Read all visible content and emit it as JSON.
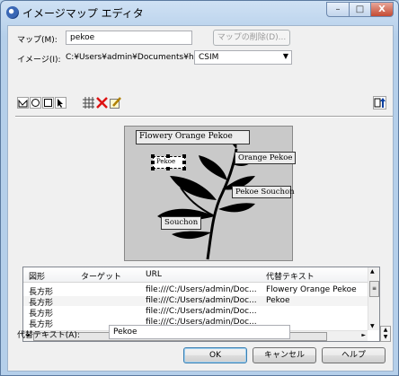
{
  "window": {
    "title": "イメージマップ エディタ",
    "min": "–",
    "max": "□",
    "close": "X"
  },
  "map": {
    "label": "マップ(M):",
    "value": "pekoe",
    "delete_label": "マップの削除(D)..."
  },
  "image": {
    "label": "イメージ(I):",
    "path": "C:¥Users¥admin¥Documents¥hpb",
    "format": "CSIM"
  },
  "canvas": {
    "labels": [
      "Flowery Orange Pekoe",
      "Orange Pekoe",
      "Pekoe",
      "Pekoe Souchon",
      "Souchon"
    ]
  },
  "list": {
    "headers": [
      "図形",
      "ターゲット",
      "URL",
      "代替テキスト"
    ],
    "rows": [
      [
        "長方形",
        "",
        "file:///C:/Users/admin/Doc...",
        "Flowery Orange Pekoe"
      ],
      [
        "長方形",
        "",
        "file:///C:/Users/admin/Doc...",
        "Pekoe"
      ],
      [
        "長方形",
        "",
        "file:///C:/Users/admin/Doc...",
        ""
      ],
      [
        "長方形",
        "",
        "file:///C:/Users/admin/Doc...",
        ""
      ]
    ],
    "selected_row": 1
  },
  "alt": {
    "label": "代替テキスト(A):",
    "value": "Pekoe"
  },
  "buttons": {
    "ok": "OK",
    "cancel": "キャンセル",
    "help": "ヘルプ"
  },
  "scroll": {
    "up": "▲",
    "down": "▼",
    "left": "◄",
    "right": "►",
    "h_grip": "III",
    "v_grip": "≡"
  }
}
